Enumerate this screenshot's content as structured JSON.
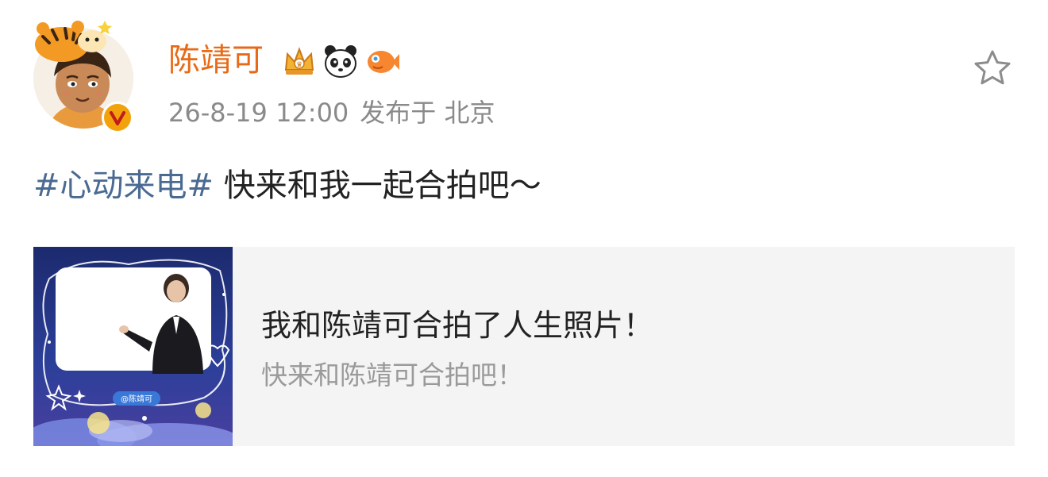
{
  "post": {
    "author": {
      "name": "陈靖可",
      "avatar_icon": "tiger-hat-cartoon-avatar",
      "verified_icon": "verified-v-badge",
      "badges": [
        "crown-badge",
        "panda-badge",
        "fish-badge"
      ]
    },
    "timestamp": "26-8-19 12:00",
    "location_prefix": "发布于",
    "location": "北京",
    "favorite_icon": "star-outline-icon",
    "hashtag": "#心动来电#",
    "text": " 快来和我一起合拍吧～"
  },
  "card": {
    "title": "我和陈靖可合拍了人生照片！",
    "subtitle": "快来和陈靖可合拍吧！",
    "thumb_tag": "@陈靖可"
  },
  "colors": {
    "username": "#e86a17",
    "hashtag": "#4a6a92",
    "meta": "#8a8a8a",
    "card_bg": "#f4f4f4",
    "verified": "#f2a20b"
  }
}
